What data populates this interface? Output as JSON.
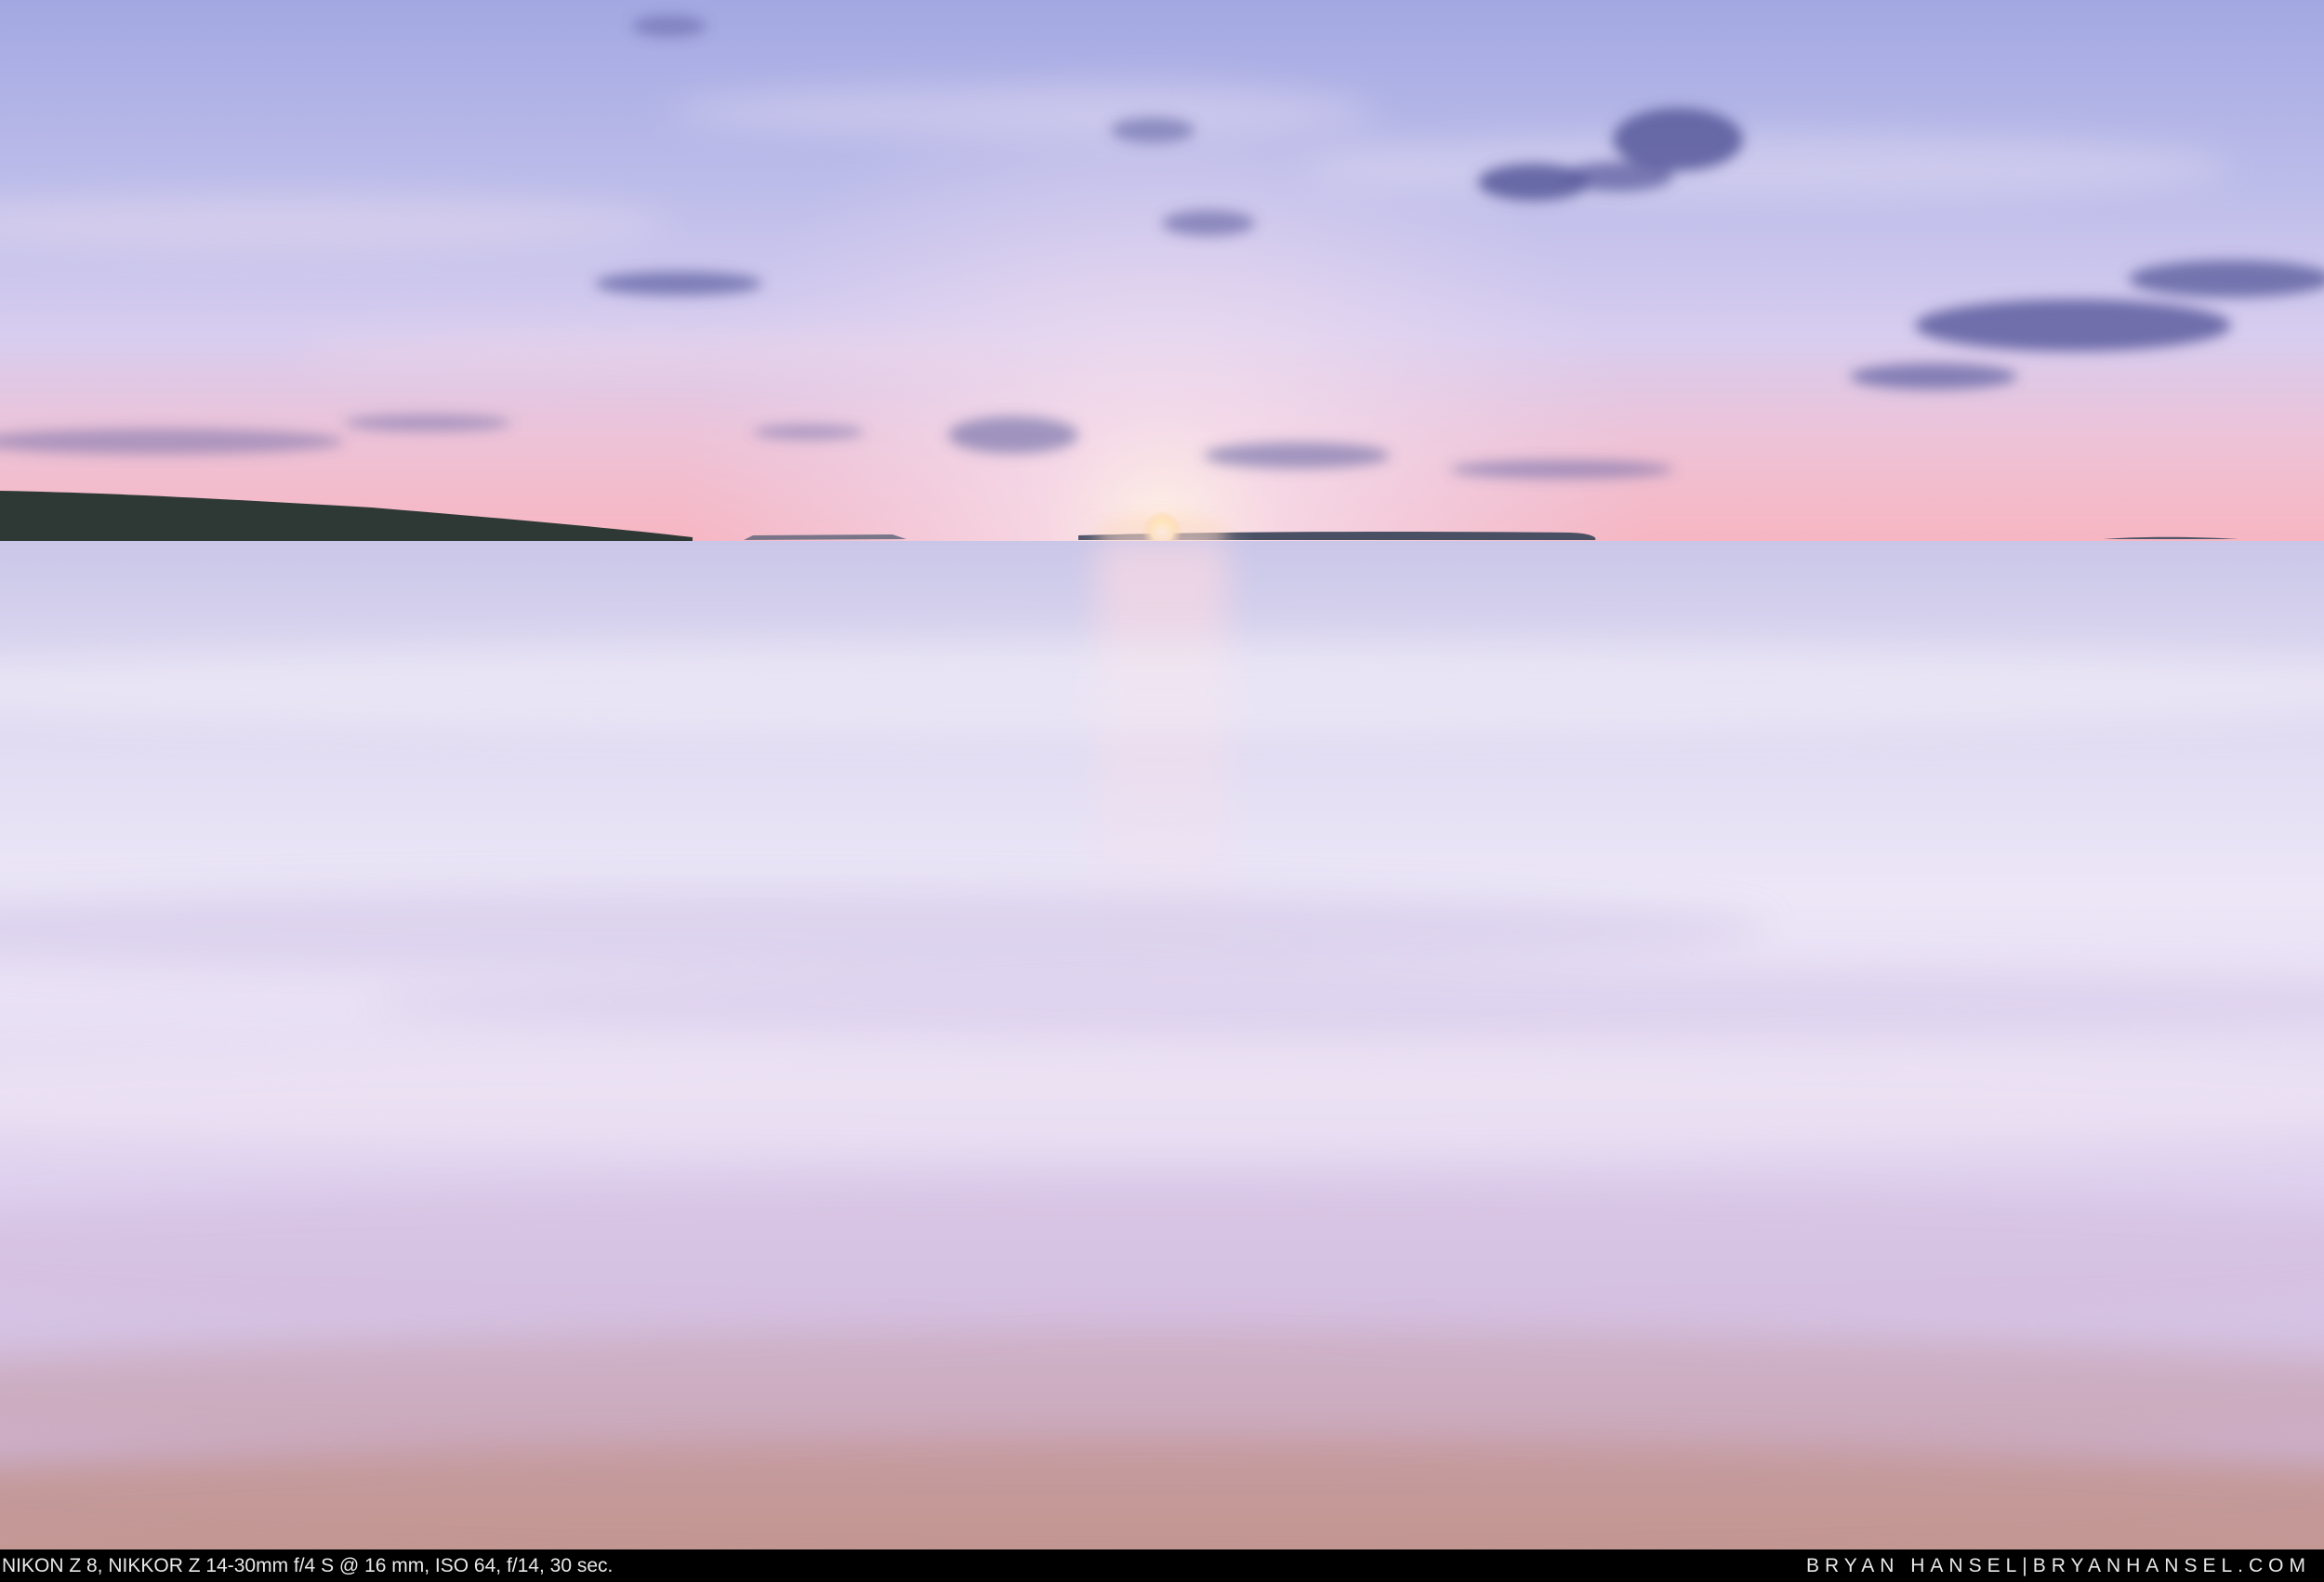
{
  "photo": {
    "subject": "sunset-over-lake-with-long-exposure-water",
    "colors": {
      "sky_top": "#a9aee6",
      "sky_mid": "#c8c6ec",
      "horizon_glow": "#f4b8c4",
      "sun": "#fff6d8",
      "water_near_horizon": "#d8d4ee",
      "water_mid": "#ece8f6",
      "water_lower": "#cfc4e6",
      "sand": "#c79d9a",
      "cloud": "#5f5f9e",
      "land": "#2f3a3a"
    }
  },
  "caption": {
    "exif": "NIKON Z 8, NIKKOR Z 14-30mm f/4 S @ 16 mm, ISO 64, f/14, 30 sec.",
    "credit": "BRYAN HANSEL|BRYANHANSEL.COM"
  }
}
